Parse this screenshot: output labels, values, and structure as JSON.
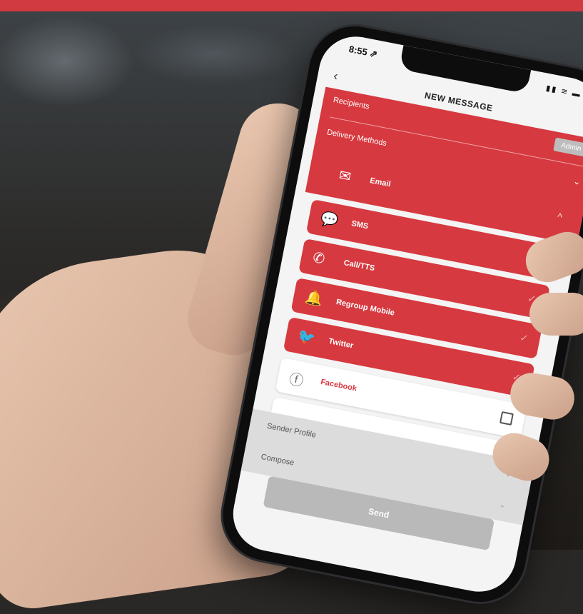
{
  "status_bar": {
    "time": "8:55 ⇗",
    "icons": "▮▮ ≋ ▬"
  },
  "header": {
    "back": "‹",
    "title": "NEW MESSAGE"
  },
  "rows": {
    "recipients": "Recipients",
    "admin_badge": "Admin",
    "delivery_methods": "Delivery Methods"
  },
  "methods": [
    {
      "label": "Email",
      "icon": "email-icon",
      "glyph": "✉",
      "state": "expanded",
      "mark": "^"
    },
    {
      "label": "SMS",
      "icon": "sms-icon",
      "glyph": "💬",
      "state": "checked",
      "mark": "✓"
    },
    {
      "label": "Call/TTS",
      "icon": "phone-icon",
      "glyph": "✆",
      "state": "checked",
      "mark": "✓"
    },
    {
      "label": "Regroup Mobile",
      "icon": "bell-icon",
      "glyph": "🔔",
      "state": "checked",
      "mark": "✓"
    },
    {
      "label": "Twitter",
      "icon": "twitter-icon",
      "glyph": "🐦",
      "state": "checked",
      "mark": "✓"
    },
    {
      "label": "Facebook",
      "icon": "facebook-icon",
      "glyph": "ⓕ",
      "state": "unchecked"
    }
  ],
  "sections": {
    "sender_profile": "Sender Profile",
    "compose": "Compose",
    "chevron": "⌄"
  },
  "send_label": "Send",
  "colors": {
    "accent": "#d6393f",
    "gray": "#dcdcdc"
  }
}
